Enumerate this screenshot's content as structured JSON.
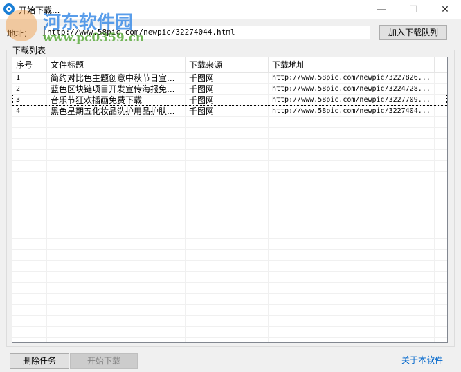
{
  "window": {
    "title": "开始下载...",
    "minimize": "—",
    "maximize": "☐",
    "close": "✕"
  },
  "address": {
    "label": "地址：",
    "value": "http://www.58pic.com/newpic/32274044.html"
  },
  "add_button": "加入下载队列",
  "group_label": "下载列表",
  "columns": [
    "序号",
    "文件标题",
    "下载来源",
    "下载地址"
  ],
  "rows": [
    [
      "1",
      "简约对比色主题创意中秋节日宣...",
      "千图网",
      "http://www.58pic.com/newpic/3227826..."
    ],
    [
      "2",
      "蓝色区块链项目开发宣传海报免...",
      "千图网",
      "http://www.58pic.com/newpic/3224728..."
    ],
    [
      "3",
      "音乐节狂欢插画免费下载",
      "千图网",
      "http://www.58pic.com/newpic/3227709..."
    ],
    [
      "4",
      "黑色星期五化妆品洗护用品护肤...",
      "千图网",
      "http://www.58pic.com/newpic/3227404..."
    ]
  ],
  "delete_button": "删除任务",
  "start_button": "开始下载",
  "about_link": "关于本软件",
  "watermark": {
    "name": "河东软件园",
    "url": "www.pc0359.cn"
  }
}
